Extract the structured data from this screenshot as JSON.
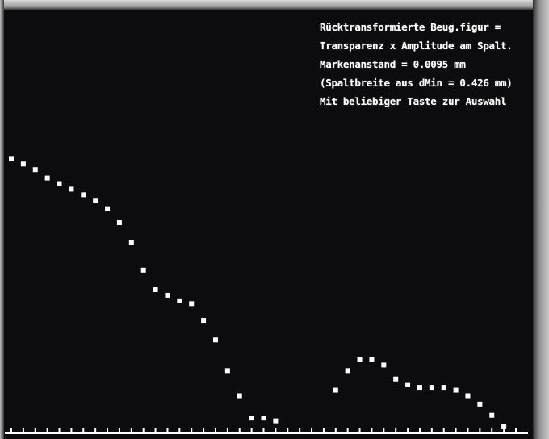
{
  "info": {
    "line1": "Rücktransformierte Beug.figur =",
    "line2": "Transparenz x Amplitude am Spalt.",
    "line3": "Markenanstand =  0.0095 mm",
    "line4": "(Spaltbreite aus dMin = 0.426 mm)",
    "line5": "Mit beliebiger Taste zur Auswahl"
  },
  "colors": {
    "screen": "#0c0c0e",
    "foreground": "#ffffff"
  },
  "chart_data": {
    "type": "scatter",
    "title": "",
    "xlabel": "",
    "ylabel": "",
    "grid": false,
    "x_tick_count": 43,
    "xlim": [
      0,
      42
    ],
    "ylim": [
      0,
      100
    ],
    "series": [
      {
        "x": [
          0,
          1,
          2,
          3,
          4,
          5,
          6,
          7,
          8,
          9,
          10,
          11,
          12,
          13,
          14,
          15,
          16,
          17,
          18,
          19,
          20,
          21,
          22,
          27,
          28,
          29,
          30,
          31,
          32,
          33,
          34,
          35,
          36,
          37,
          38,
          39,
          40,
          41
        ],
        "y": [
          97,
          95,
          93,
          90,
          88,
          86,
          84,
          82,
          79,
          74,
          67,
          57,
          50,
          48,
          46,
          45,
          39,
          32,
          21,
          12,
          4,
          4,
          3,
          14,
          21,
          25,
          25,
          23,
          18,
          16,
          15,
          15,
          15,
          14,
          12,
          9,
          5,
          1
        ]
      }
    ]
  }
}
